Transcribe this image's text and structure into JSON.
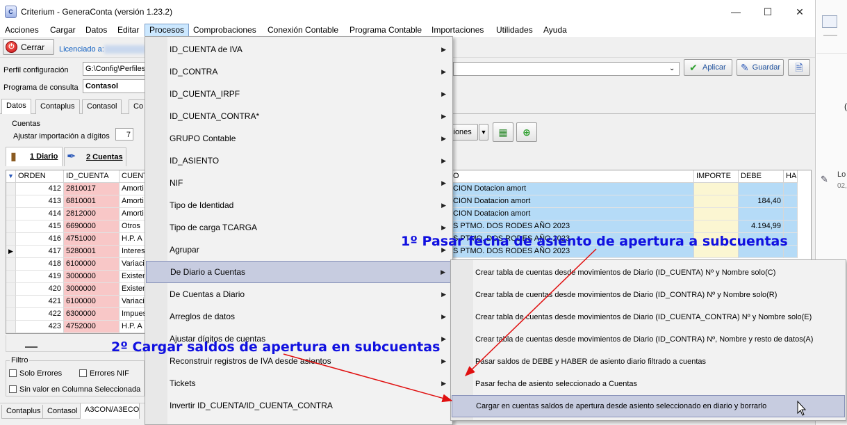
{
  "window": {
    "title": "Criterium - GeneraConta (versión 1.23.2)",
    "app_icon_text": "C"
  },
  "menubar": {
    "items": [
      "Acciones",
      "Cargar",
      "Datos",
      "Editar",
      "Procesos",
      "Comprobaciones",
      "Conexión Contable",
      "Programa Contable",
      "Importaciones",
      "Utilidades",
      "Ayuda"
    ]
  },
  "toolbar": {
    "close_label": "Cerrar",
    "licensed_label": "Licenciado a:"
  },
  "config": {
    "profile_label": "Perfil configuración",
    "profile_value": "G:\\Config\\Perfiles",
    "program_label": "Programa de consulta",
    "program_value": "Contasol",
    "apply_label": "Aplicar",
    "save_label": "Guardar"
  },
  "tabs": [
    "Datos",
    "Contaplus",
    "Contasol",
    "Co"
  ],
  "cuentas": {
    "group_label": "Cuentas",
    "adjust_label": "Ajustar importación a dígitos",
    "adjust_value": "7",
    "options_label": "ciones"
  },
  "subtabs": [
    "1 Diario",
    "2 Cuentas"
  ],
  "grid": {
    "headers": [
      "ORDEN",
      "ID_CUENTA",
      "CUENT",
      "O",
      "IMPORTE",
      "DEBE",
      "HA"
    ],
    "rows": [
      {
        "orden": "412",
        "id": "2810017",
        "cta": "Amorti",
        "desc": "CION Dotacion amort",
        "debe": ""
      },
      {
        "orden": "413",
        "id": "6810001",
        "cta": "Amorti",
        "desc": "CION Doatacion amort",
        "debe": "184,40"
      },
      {
        "orden": "414",
        "id": "2812000",
        "cta": "Amorti",
        "desc": "CION Doatacion amort",
        "debe": ""
      },
      {
        "orden": "415",
        "id": "6690000",
        "cta": "Otros",
        "desc": "S PTMO. DOS RODES AÑO 2023",
        "debe": "4.194,99"
      },
      {
        "orden": "416",
        "id": "4751000",
        "cta": "H.P. A",
        "desc": "S PTMO. DOS RODES AÑO 2023",
        "debe": ""
      },
      {
        "orden": "417",
        "id": "5280001",
        "cta": "Interes",
        "desc": "S PTMO. DOS RODES AÑO 2023",
        "debe": ""
      },
      {
        "orden": "418",
        "id": "6100000",
        "cta": "Variaci",
        "desc": "",
        "debe": ""
      },
      {
        "orden": "419",
        "id": "3000000",
        "cta": "Existen",
        "desc": "",
        "debe": ""
      },
      {
        "orden": "420",
        "id": "3000000",
        "cta": "Existen",
        "desc": "",
        "debe": ""
      },
      {
        "orden": "421",
        "id": "6100000",
        "cta": "Variaci",
        "desc": "",
        "debe": ""
      },
      {
        "orden": "422",
        "id": "6300000",
        "cta": "Impues",
        "desc": "",
        "debe": ""
      },
      {
        "orden": "423",
        "id": "4752000",
        "cta": "H.P. A",
        "desc": "",
        "debe": ""
      }
    ]
  },
  "filter": {
    "group_label": "Filtro",
    "only_errors": "Solo Errores",
    "nif_errors": "Errores NIF",
    "no_value": "Sin valor en Columna Seleccionada"
  },
  "bottom_tabs": [
    "Contaplus",
    "Contasol",
    "A3CON/A3ECO"
  ],
  "procesos_menu": {
    "items": [
      "ID_CUENTA de IVA",
      "ID_CONTRA",
      "ID_CUENTA_IRPF",
      "ID_CUENTA_CONTRA*",
      "GRUPO Contable",
      "ID_ASIENTO",
      "NIF",
      "Tipo de Identidad",
      "Tipo de carga TCARGA",
      "Agrupar",
      "De Diario a Cuentas",
      "De Cuentas a Diario",
      "Arreglos de datos",
      "Ajustar dígitos de cuentas",
      "Reconstruir registros de IVA desde asientos",
      "Tickets",
      "Invertir ID_CUENTA/ID_CUENTA_CONTRA"
    ]
  },
  "submenu": {
    "items": [
      "Crear tabla de cuentas desde movimientos de Diario (ID_CUENTA) Nº y Nombre solo(C)",
      "Crear tabla de cuentas desde movimientos de Diario (ID_CONTRA) Nº y Nombre solo(R)",
      "Crear tabla de cuentas desde movimientos de Diario (ID_CUENTA_CONTRA) Nº y Nombre solo(E)",
      "Crear tabla de cuentas desde movimientos de Diario (ID_CONTRA) Nº, Nombre y resto de datos(A)",
      "Pasar saldos de DEBE y HABER de asiento diario filtrado a cuentas",
      "Pasar fecha de asiento seleccionado a Cuentas",
      "Cargar en cuentas saldos de apertura desde asiento seleccionado en diario y borrarlo"
    ]
  },
  "annotations": {
    "first": "1º Pasar fecha de asiento de apertura a subcuentas",
    "second": "2º Cargar saldos de apertura en subcuentas"
  },
  "desktop_right": {
    "text1": "Lo",
    "text2": "02,"
  },
  "colors": {
    "annotation": "#1010e0",
    "arrow": "#e01010",
    "id_cell": "#f8c7c7",
    "selected_cell": "#b5dbf7",
    "highlight": "#c7cce0"
  }
}
